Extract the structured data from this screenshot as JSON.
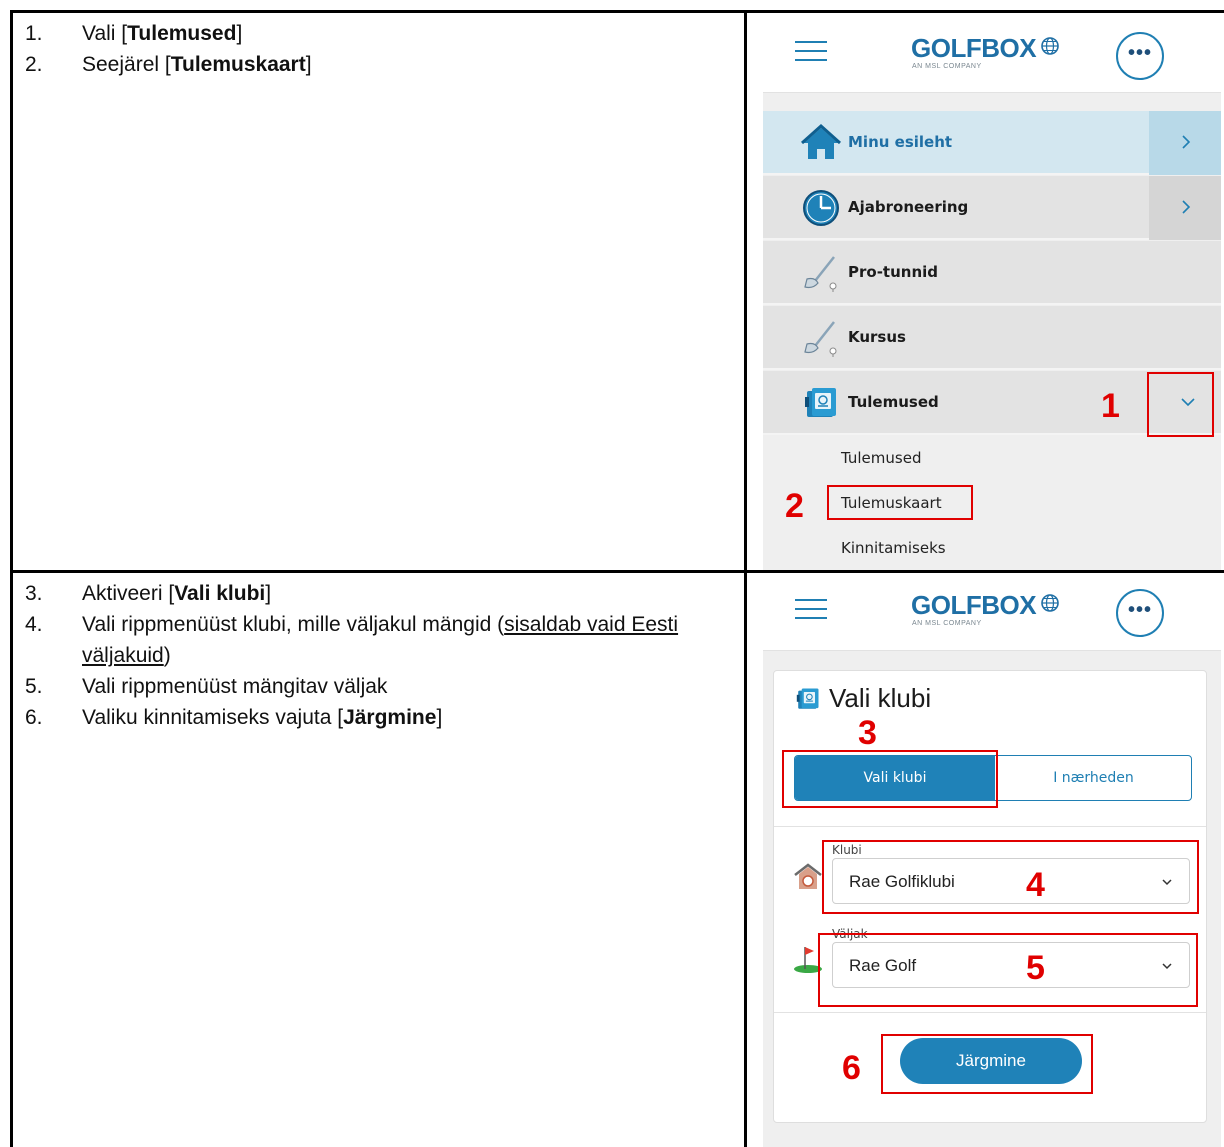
{
  "steps_top": [
    {
      "num": "1.",
      "pre": "Vali [",
      "bold": "Tulemused",
      "post": "]"
    },
    {
      "num": "2.",
      "pre": "Seejärel [",
      "bold": "Tulemuskaart",
      "post": "]"
    }
  ],
  "steps_bottom": {
    "s3": {
      "num": "3.",
      "pre": "Aktiveeri [",
      "bold": "Vali klubi",
      "post": "]"
    },
    "s4": {
      "num": "4.",
      "pre": "Vali rippmenüüst klubi, mille väljakul mängid (",
      "underline": "sisaldab vaid Eesti väljakuid",
      "post": ")"
    },
    "s5": {
      "num": "5.",
      "text": "Vali rippmenüüst mängitav väljak"
    },
    "s6": {
      "num": "6.",
      "pre": "Valiku kinnitamiseks vajuta [",
      "bold": "Järgmine",
      "post": "]"
    }
  },
  "app": {
    "logo_word": "GOLFBOX",
    "logo_sub": "AN MSL COMPANY",
    "more_label": "•••"
  },
  "menu": {
    "items": [
      {
        "label": "Minu esileht",
        "icon": "home-icon"
      },
      {
        "label": "Ajabroneering",
        "icon": "clock-icon"
      },
      {
        "label": "Pro-tunnid",
        "icon": "golf-club-icon"
      },
      {
        "label": "Kursus",
        "icon": "golf-club-icon"
      },
      {
        "label": "Tulemused",
        "icon": "scorecard-icon"
      }
    ],
    "submenu": [
      "Tulemused",
      "Tulemuskaart",
      "Kinnitamiseks"
    ]
  },
  "form": {
    "title": "Vali klubi",
    "tab_active": "Vali klubi",
    "tab_inactive": "I nærheden",
    "club_label": "Klubi",
    "club_value": "Rae Golfiklubi",
    "course_label": "Väljak",
    "course_value": "Rae Golf",
    "next_label": "Järgmine"
  },
  "markers": [
    "1",
    "2",
    "3",
    "4",
    "5",
    "6"
  ],
  "colors": {
    "accent": "#1f82b8",
    "marker_red": "#e00000",
    "active_row": "#d3e7f0"
  }
}
